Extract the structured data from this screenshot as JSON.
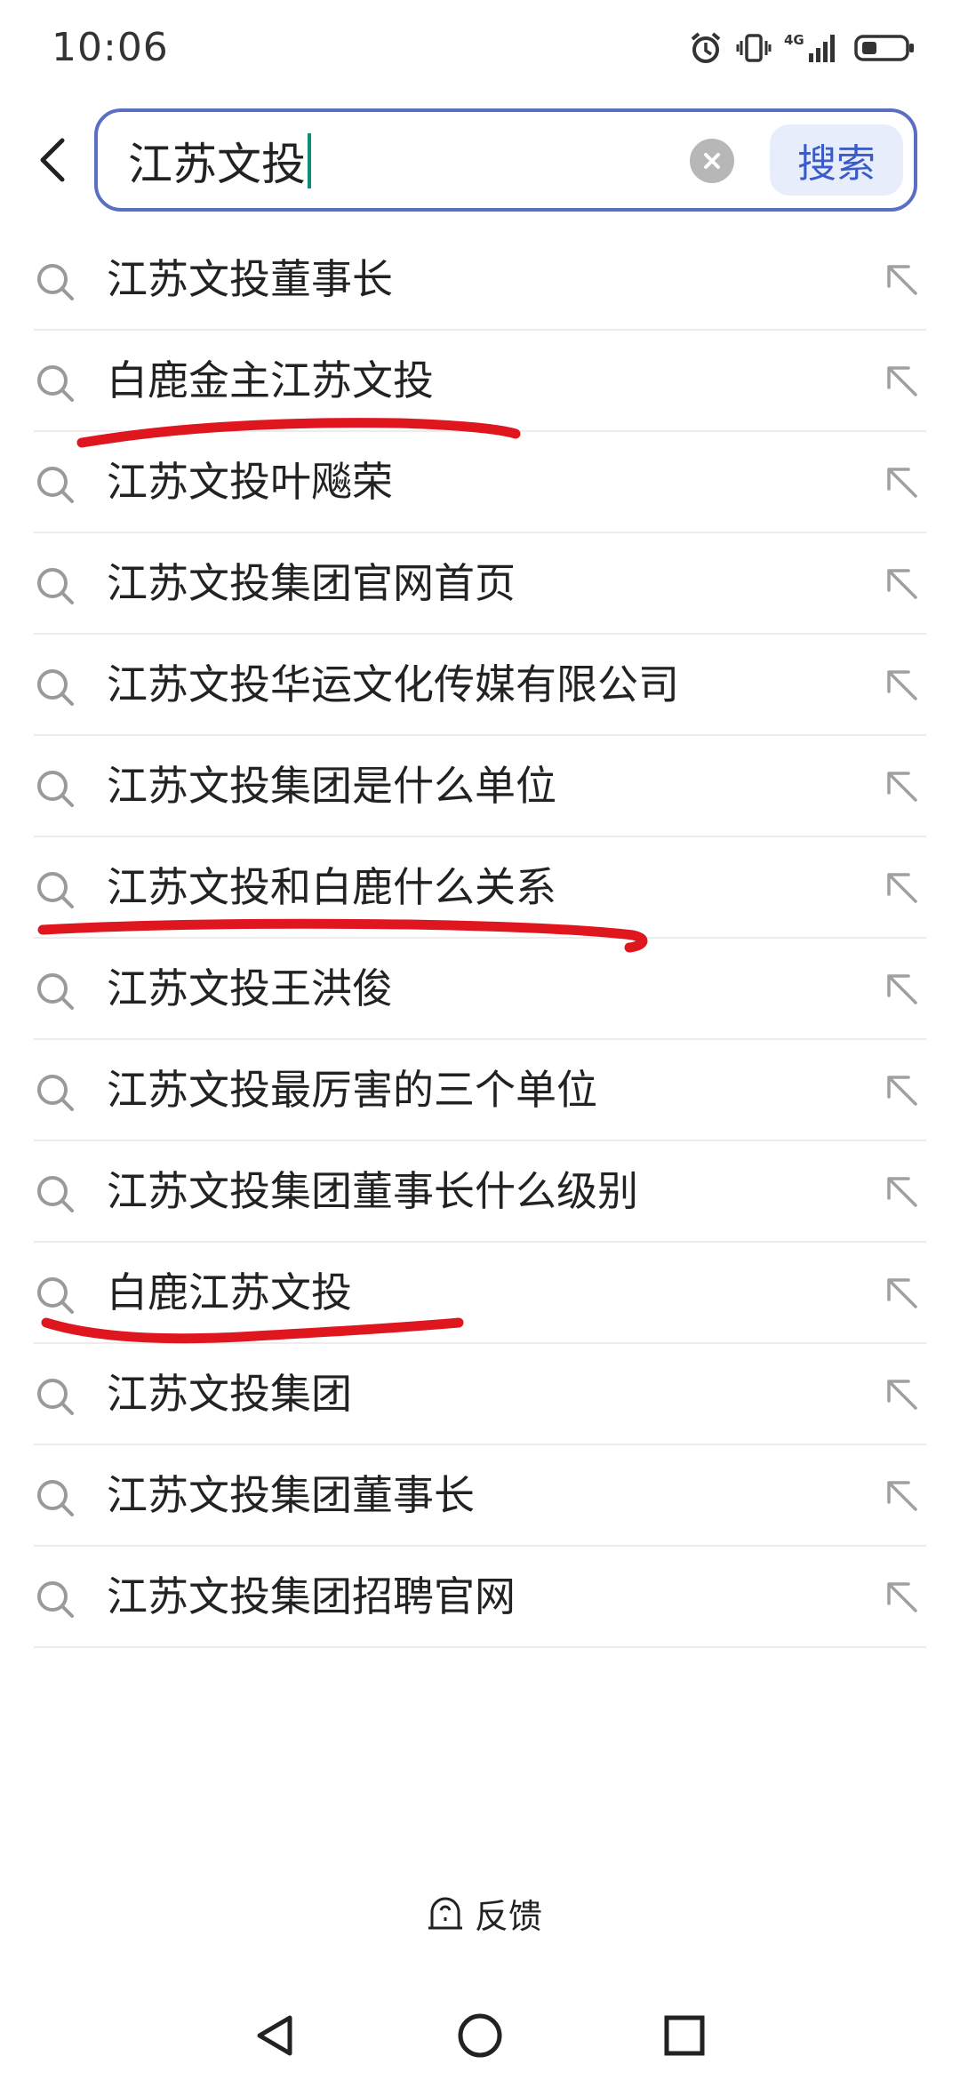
{
  "status_bar": {
    "time": "10:06",
    "icons": [
      "alarm-icon",
      "vibrate-icon",
      "signal-4g-icon",
      "battery-icon"
    ],
    "network": "4G"
  },
  "search": {
    "query": "江苏文投",
    "search_button": "搜索",
    "accent_color": "#5a6fc4"
  },
  "suggestions": [
    {
      "text": "江苏文投董事长"
    },
    {
      "text": "白鹿金主江苏文投"
    },
    {
      "text": "江苏文投叶飚荣"
    },
    {
      "text": "江苏文投集团官网首页"
    },
    {
      "text": "江苏文投华运文化传媒有限公司"
    },
    {
      "text": "江苏文投集团是什么单位"
    },
    {
      "text": "江苏文投和白鹿什么关系"
    },
    {
      "text": "江苏文投王洪俊"
    },
    {
      "text": "江苏文投最厉害的三个单位"
    },
    {
      "text": "江苏文投集团董事长什么级别"
    },
    {
      "text": "白鹿江苏文投"
    },
    {
      "text": "江苏文投集团"
    },
    {
      "text": "江苏文投集团董事长"
    },
    {
      "text": "江苏文投集团招聘官网"
    }
  ],
  "annotations": {
    "color": "#e0161f",
    "underlined_items": [
      "白鹿金主江苏文投",
      "江苏文投和白鹿什么关系",
      "白鹿江苏文投"
    ]
  },
  "feedback": {
    "label": "反馈"
  },
  "nav": {
    "icons": [
      "back-triangle-icon",
      "home-circle-icon",
      "recents-square-icon"
    ]
  }
}
